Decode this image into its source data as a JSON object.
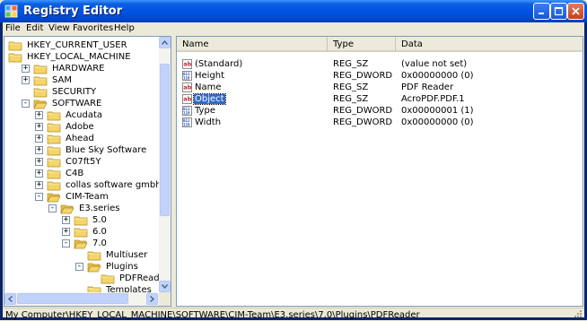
{
  "window": {
    "title": "Registry Editor",
    "app_icon": "registry-icon",
    "controls": [
      "minimize-icon",
      "maximize-icon",
      "close-icon"
    ]
  },
  "menu": [
    "File",
    "Edit",
    "View",
    "Favorites",
    "Help"
  ],
  "tree": [
    {
      "label": "HKEY_CURRENT_USER",
      "expander": "none"
    },
    {
      "label": "HKEY_LOCAL_MACHINE",
      "expander": "none"
    },
    {
      "label": "HARDWARE",
      "expander": "+"
    },
    {
      "label": "SAM",
      "expander": "+"
    },
    {
      "label": "SECURITY",
      "expander": "none"
    },
    {
      "label": "SOFTWARE",
      "expander": "-"
    },
    {
      "label": "Acudata",
      "expander": "+"
    },
    {
      "label": "Adobe",
      "expander": "+"
    },
    {
      "label": "Ahead",
      "expander": "+"
    },
    {
      "label": "Blue Sky Software",
      "expander": "+"
    },
    {
      "label": "C07ft5Y",
      "expander": "+"
    },
    {
      "label": "C4B",
      "expander": "+"
    },
    {
      "label": "collas software gmbh",
      "expander": "+"
    },
    {
      "label": "CIM-Team",
      "expander": "-"
    },
    {
      "label": "E3.series",
      "expander": "-"
    },
    {
      "label": "5.0",
      "expander": "+"
    },
    {
      "label": "6.0",
      "expander": "+"
    },
    {
      "label": "7.0",
      "expander": "-"
    },
    {
      "label": "Multiuser",
      "expander": "none"
    },
    {
      "label": "Plugins",
      "expander": "-"
    },
    {
      "label": "PDFReader",
      "expander": "none"
    },
    {
      "label": "Templates",
      "expander": "none"
    }
  ],
  "list": {
    "columns": [
      "Name",
      "Type",
      "Data"
    ],
    "rows": [
      {
        "name": "(Standard)",
        "type": "REG_SZ",
        "data": "(value not set)",
        "icon": "string-value-icon",
        "selected": false
      },
      {
        "name": "Height",
        "type": "REG_DWORD",
        "data": "0x00000000 (0)",
        "icon": "binary-value-icon",
        "selected": false
      },
      {
        "name": "Name",
        "type": "REG_SZ",
        "data": "PDF Reader",
        "icon": "string-value-icon",
        "selected": false
      },
      {
        "name": "Object",
        "type": "REG_SZ",
        "data": "AcroPDF.PDF.1",
        "icon": "string-value-icon",
        "selected": true
      },
      {
        "name": "Type",
        "type": "REG_DWORD",
        "data": "0x00000001 (1)",
        "icon": "binary-value-icon",
        "selected": false
      },
      {
        "name": "Width",
        "type": "REG_DWORD",
        "data": "0x00000000 (0)",
        "icon": "binary-value-icon",
        "selected": false
      }
    ]
  },
  "status": "My Computer\\HKEY_LOCAL_MACHINE\\SOFTWARE\\CIM-Team\\E3.series\\7.0\\Plugins\\PDFReader",
  "colors": {
    "titlebar": "#0054e3",
    "selection": "#316ac5",
    "folder": "#f5d56a"
  }
}
